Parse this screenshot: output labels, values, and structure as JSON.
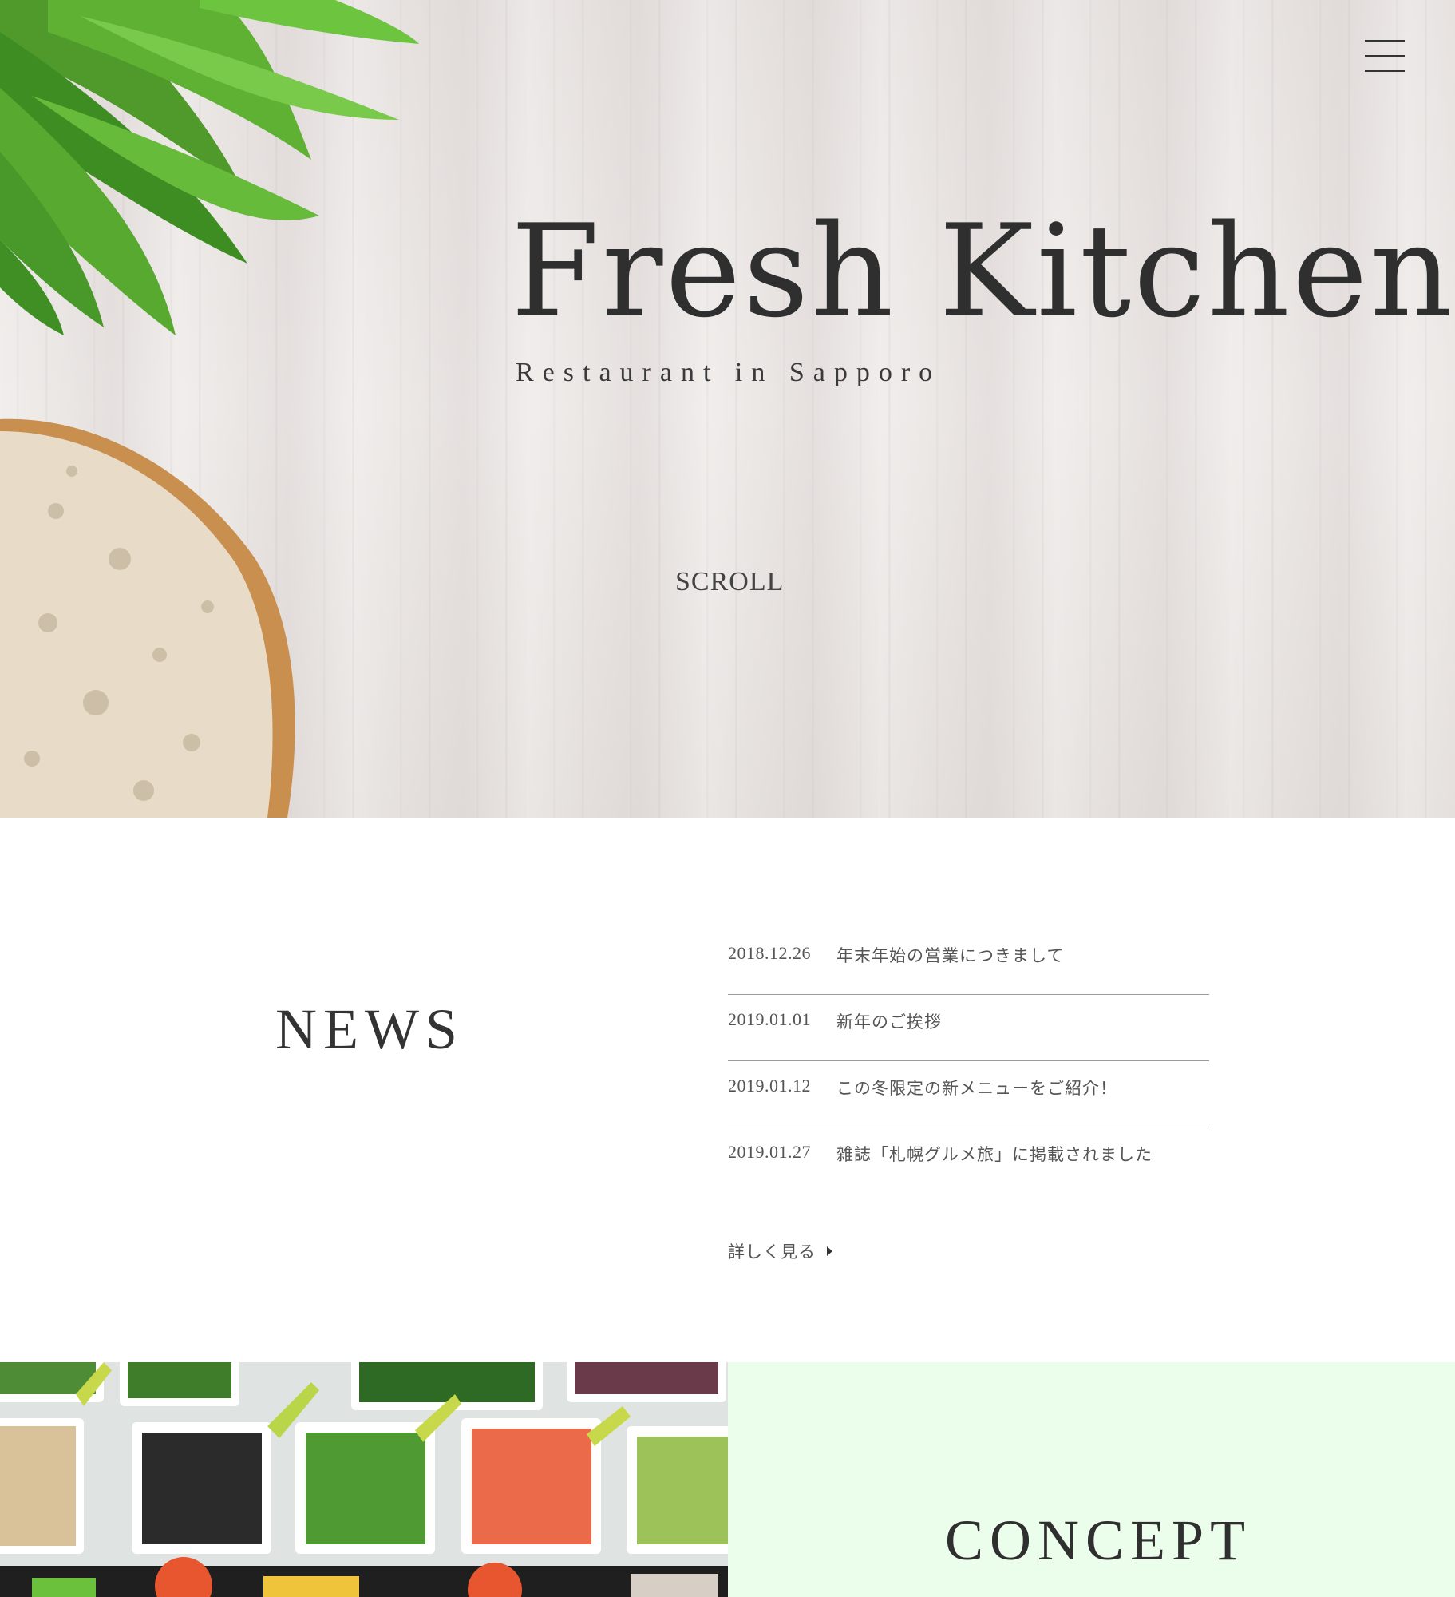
{
  "hero": {
    "title": "Fresh Kitchen",
    "subtitle": "Restaurant in Sapporo",
    "scroll_label": "SCROLL"
  },
  "menu": {
    "icon": "hamburger-menu-icon"
  },
  "news": {
    "heading": "NEWS",
    "items": [
      {
        "date": "2018.12.26",
        "text": "年末年始の営業につきまして"
      },
      {
        "date": "2019.01.01",
        "text": "新年のご挨拶"
      },
      {
        "date": "2019.01.12",
        "text": "この冬限定の新メニューをご紹介！"
      },
      {
        "date": "2019.01.27",
        "text": "雑誌「札幌グルメ旅」に掲載されました"
      }
    ],
    "more_label": "詳しく見る"
  },
  "concept": {
    "heading": "CONCEPT"
  },
  "colors": {
    "concept_bg": "#ebfeeb",
    "text": "#333333",
    "divider": "#9a9a9a"
  }
}
